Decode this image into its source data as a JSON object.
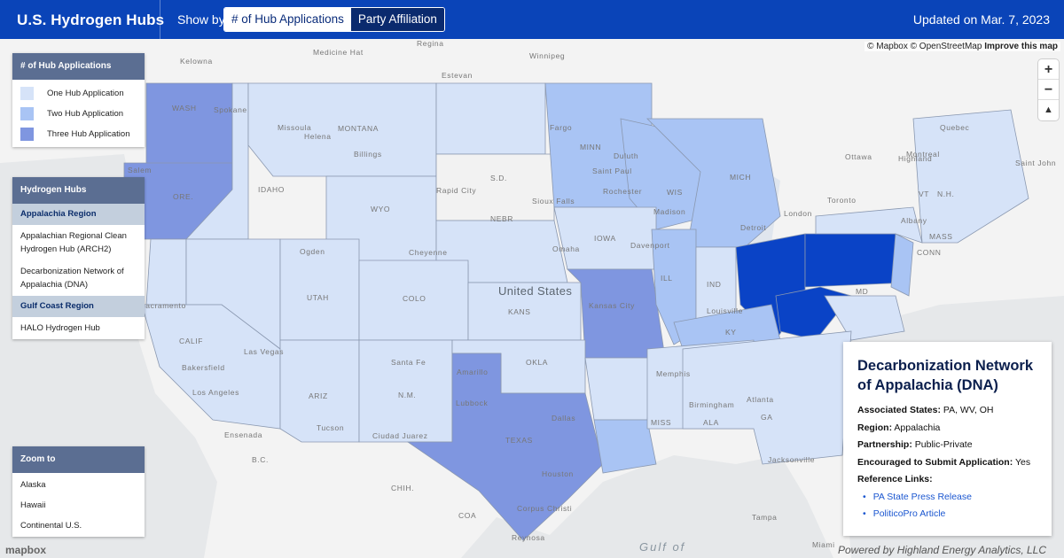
{
  "header": {
    "title": "U.S. Hydrogen Hubs",
    "show_by_label": "Show by",
    "toggle_options": [
      "# of Hub Applications",
      "Party Affiliation"
    ],
    "updated": "Updated on Mar. 7, 2023"
  },
  "map": {
    "attribution_mapbox": "© Mapbox",
    "attribution_osm": "© OpenStreetMap",
    "attribution_improve": "Improve this map",
    "zoom_in": "+",
    "zoom_out": "−",
    "compass": "▲",
    "country_label": "United States",
    "gulf_label": "Gulf of",
    "mapbox_logo": "mapbox",
    "footer_credit": "Powered by Highland Energy Analytics, LLC",
    "colors": {
      "one": "#d6e3f8",
      "two": "#a9c4f4",
      "three": "#7f96e0",
      "selected": "#0a43c6",
      "land": "#f3f3f3",
      "water": "#e6e8ea"
    },
    "place_labels": [
      "Kelowna",
      "Regina",
      "Winnipeg",
      "Estevan",
      "Medicine Hat",
      "Spokane",
      "Salem",
      "Missoula",
      "Helena",
      "MONTANA",
      "Billings",
      "IDAHO",
      "WYO",
      "Rapid City",
      "S.D.",
      "Sioux Falls",
      "Fargo",
      "MINN",
      "Duluth",
      "Saint Paul",
      "Rochester",
      "WIS",
      "Madison",
      "MICH",
      "Detroit",
      "Ottawa",
      "Montreal",
      "Quebec",
      "Highland",
      "Saint John",
      "Toronto",
      "London",
      "Albany",
      "NEBR",
      "Cheyenne",
      "Omaha",
      "IOWA",
      "Davenport",
      "Ogden",
      "UTAH",
      "COLO",
      "KANS",
      "Kansas City",
      "ILL",
      "IND",
      "Louisville",
      "KY",
      "Sacramento",
      "CALIF",
      "Las Vegas",
      "Bakersfield",
      "Los Angeles",
      "ARIZ",
      "Santa Fe",
      "N.M.",
      "OKLA",
      "Memphis",
      "Amarillo",
      "Lubbock",
      "Dallas",
      "TEXAS",
      "Houston",
      "Corpus Christi",
      "Reynosa",
      "Ciudad Juarez",
      "Tucson",
      "Ensenada",
      "MISS",
      "Birmingham",
      "ALA",
      "Atlanta",
      "GA",
      "Jacksonville",
      "Miami",
      "Tampa",
      "B.C.",
      "CHIH.",
      "COA",
      "MD",
      "MASS",
      "CONN",
      "VT",
      "N.H.",
      "WASH",
      "ORE."
    ]
  },
  "legend": {
    "title": "# of Hub Applications",
    "items": [
      {
        "label": "One Hub Application",
        "color": "#d6e3f8"
      },
      {
        "label": "Two Hub Application",
        "color": "#a9c4f4"
      },
      {
        "label": "Three Hub Application",
        "color": "#7f96e0"
      }
    ]
  },
  "hubs": {
    "title": "Hydrogen Hubs",
    "regions": [
      {
        "name": "Appalachia Region",
        "items": [
          "Appalachian Regional Clean Hydrogen Hub (ARCH2)",
          "Decarbonization Network of Appalachia (DNA)"
        ]
      },
      {
        "name": "Gulf Coast Region",
        "items": [
          "HALO Hydrogen Hub"
        ]
      }
    ]
  },
  "zoom": {
    "title": "Zoom to",
    "items": [
      "Alaska",
      "Hawaii",
      "Continental U.S."
    ]
  },
  "info": {
    "title": "Decarbonization Network of Appalachia (DNA)",
    "states_label": "Associated States:",
    "states_value": "PA, WV, OH",
    "region_label": "Region:",
    "region_value": "Appalachia",
    "partnership_label": "Partnership:",
    "partnership_value": "Public-Private",
    "encouraged_label": "Encouraged to Submit Application:",
    "encouraged_value": "Yes",
    "links_label": "Reference Links:",
    "links": [
      "PA State Press Release",
      "PoliticoPro Article"
    ]
  }
}
